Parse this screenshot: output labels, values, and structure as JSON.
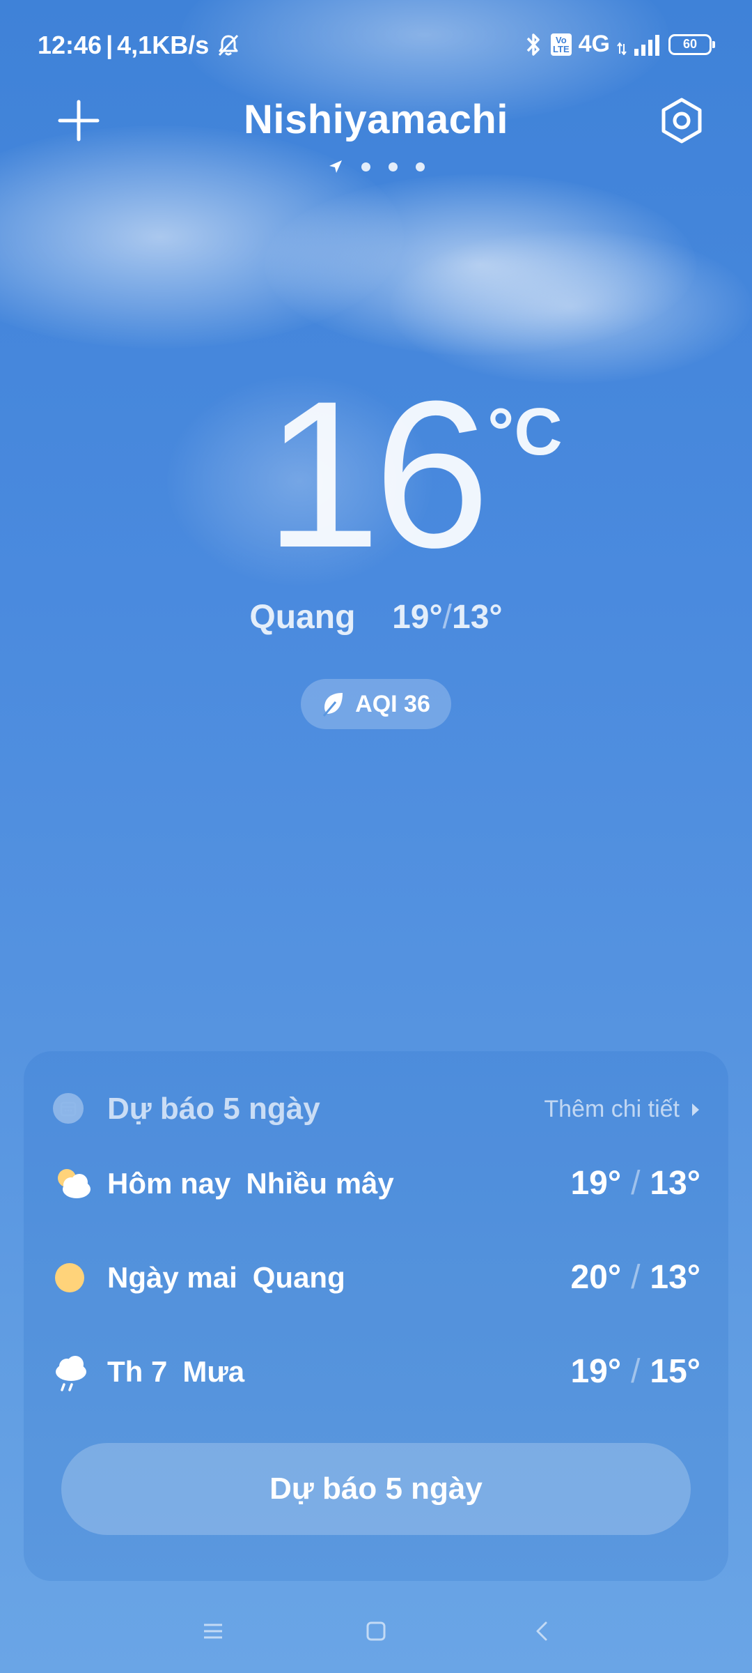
{
  "status_bar": {
    "time": "12:46",
    "separator": "|",
    "net_speed": "4,1KB/s",
    "volte_label": "Vo\nLTE",
    "network": "4G",
    "battery_level": "60",
    "icons": [
      "muted-bell-icon",
      "bluetooth-icon",
      "volte-icon",
      "data-arrows-icon",
      "signal-icon",
      "battery-icon"
    ]
  },
  "header": {
    "city": "Nishiyamachi",
    "page_count": 4,
    "current_page": 0
  },
  "current": {
    "temperature": "16",
    "unit": "°C",
    "condition": "Quang",
    "high_low_high": "19°",
    "high_low_sep": "/",
    "high_low_low": "13°",
    "aqi_label": "AQI 36"
  },
  "forecast": {
    "title": "Dự báo 5 ngày",
    "more_label": "Thêm chi tiết",
    "rows": [
      {
        "day": "Hôm nay",
        "condition": "Nhiều mây",
        "high": "19°",
        "sep": "/",
        "low": "13°",
        "icon": "partly-cloudy-icon"
      },
      {
        "day": "Ngày mai",
        "condition": "Quang",
        "high": "20°",
        "sep": "/",
        "low": "13°",
        "icon": "sun-icon"
      },
      {
        "day": "Th 7",
        "condition": "Mưa",
        "high": "19°",
        "sep": "/",
        "low": "15°",
        "icon": "rain-cloud-icon"
      }
    ],
    "button_label": "Dự báo 5 ngày"
  },
  "colors": {
    "sky_top": "#3f82d8",
    "sky_bottom": "#6aa5e6",
    "sun": "#ffd37a"
  }
}
